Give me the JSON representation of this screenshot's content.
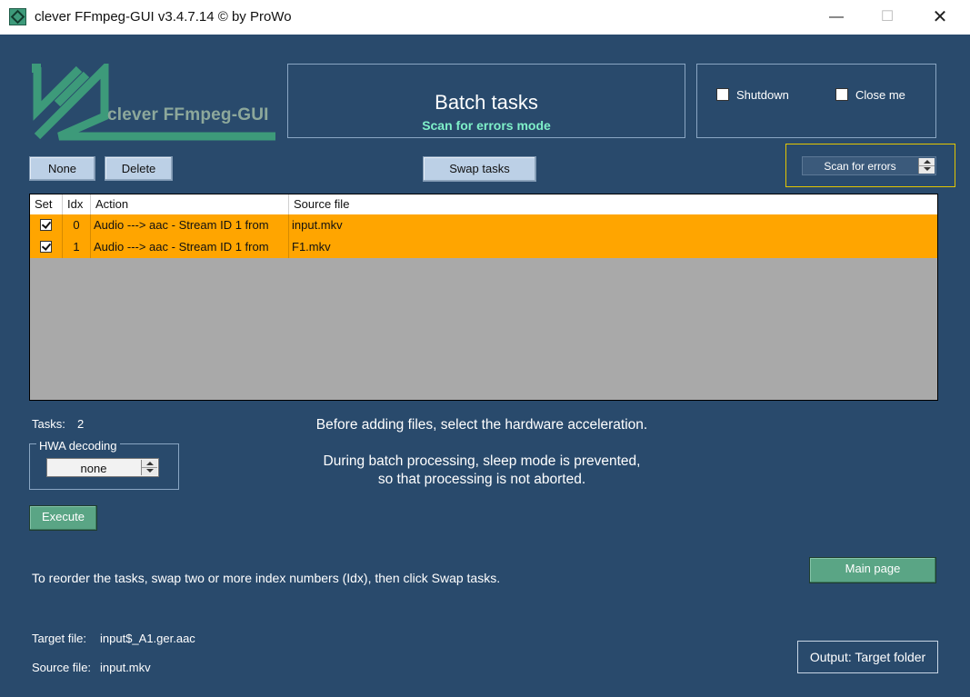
{
  "window": {
    "title": "clever FFmpeg-GUI v3.4.7.14   © by ProWo",
    "minimize_glyph": "—",
    "maximize_glyph": "☐",
    "close_glyph": "✕"
  },
  "logo": {
    "text": "clever FFmpeg-GUI"
  },
  "header": {
    "title": "Batch tasks",
    "subtitle": "Scan for errors mode"
  },
  "options": {
    "shutdown_label": "Shutdown",
    "shutdown_checked": false,
    "close_me_label": "Close me",
    "close_me_checked": false
  },
  "toolbar": {
    "none_label": "None",
    "delete_label": "Delete",
    "swap_label": "Swap tasks"
  },
  "mode_select": {
    "value": "Scan for errors"
  },
  "table": {
    "columns": [
      "Set",
      "Idx",
      "Action",
      "Source file"
    ],
    "rows": [
      {
        "set": true,
        "idx": "0",
        "action": "Audio ---> aac - Stream ID 1 from",
        "source": "input.mkv"
      },
      {
        "set": true,
        "idx": "1",
        "action": "Audio ---> aac - Stream ID 1 from",
        "source": "F1.mkv"
      }
    ]
  },
  "tasks": {
    "label": "Tasks:",
    "count": "2"
  },
  "hwa": {
    "legend": "HWA decoding",
    "value": "none"
  },
  "messages": {
    "line1": "Before adding files, select the hardware acceleration.",
    "line2": "During batch processing, sleep mode is prevented,",
    "line3": "so that processing is not aborted."
  },
  "execute_label": "Execute",
  "reorder_hint": "To reorder the tasks, swap two or more index numbers (Idx), then click Swap tasks.",
  "main_page_label": "Main page",
  "footer": {
    "target_label": "Target file:",
    "target_value": "input$_A1.ger.aac",
    "source_label": "Source file:",
    "source_value": "input.mkv",
    "output_label": "Output: Target folder"
  },
  "colors": {
    "background": "#294a6c",
    "row_highlight": "#ffa500",
    "accent_green": "#5aa585",
    "subtitle": "#7ff0c9"
  }
}
